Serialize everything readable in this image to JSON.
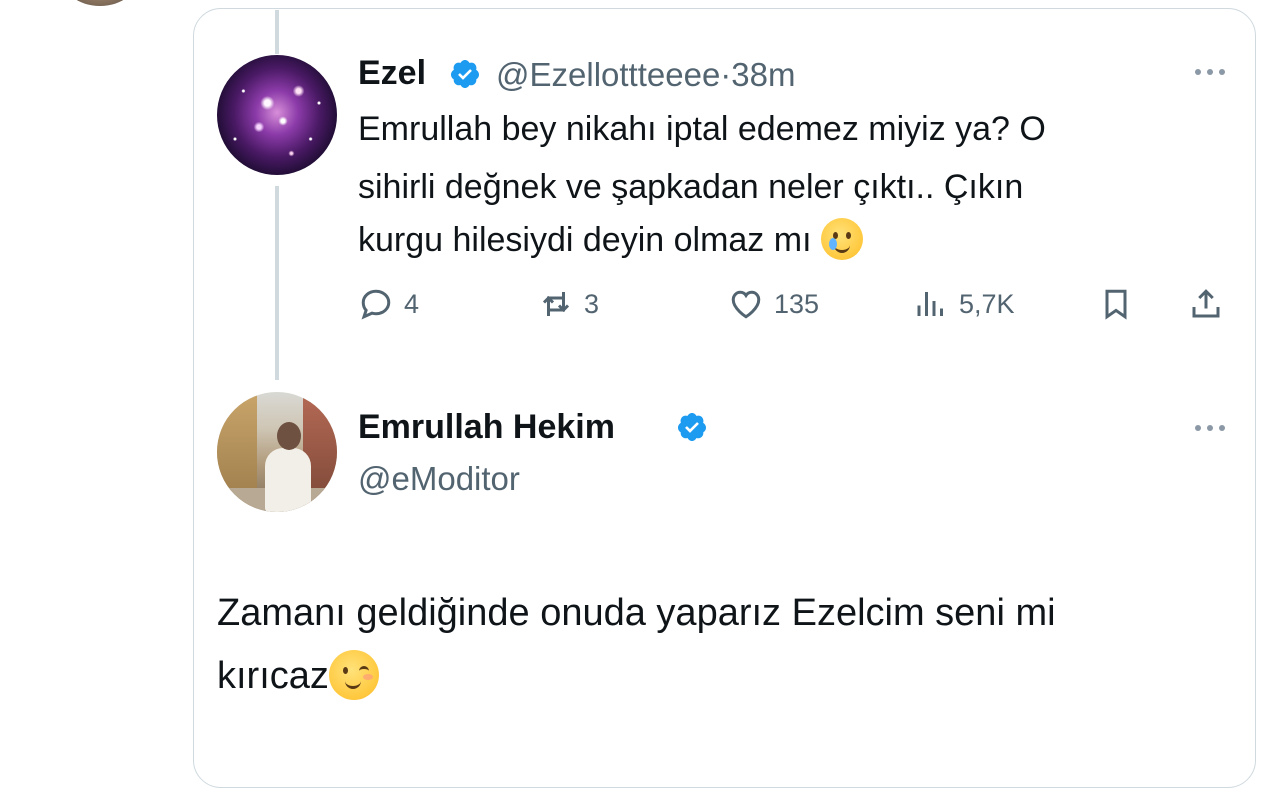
{
  "reply_tweet": {
    "name": "Ezel",
    "handle": "@Ezellottteeee",
    "separator": "·",
    "time": "38m",
    "text_line1": "Emrullah bey nikahı iptal edemez miyiz ya? O",
    "text_line2": "sihirli değnek ve şapkadan neler çıktı.. Çıkın",
    "text_line3": "kurgu hilesiydi deyin olmaz mı",
    "emoji_icon": "face-holding-back-tears-icon",
    "stats": {
      "replies": "4",
      "reposts": "3",
      "likes": "135",
      "views": "5,7K"
    }
  },
  "main_tweet": {
    "name": "Emrullah Hekim",
    "handle": "@eModitor",
    "text_line1": "Zamanı geldiğinde onuda yaparız Ezelcim seni mi",
    "text_line2": "kırıcaz",
    "emoji_icon": "winking-face-icon"
  },
  "colors": {
    "text": "#0f1419",
    "muted": "#536471",
    "verified": "#1d9bf0",
    "border": "#cfd9de"
  }
}
